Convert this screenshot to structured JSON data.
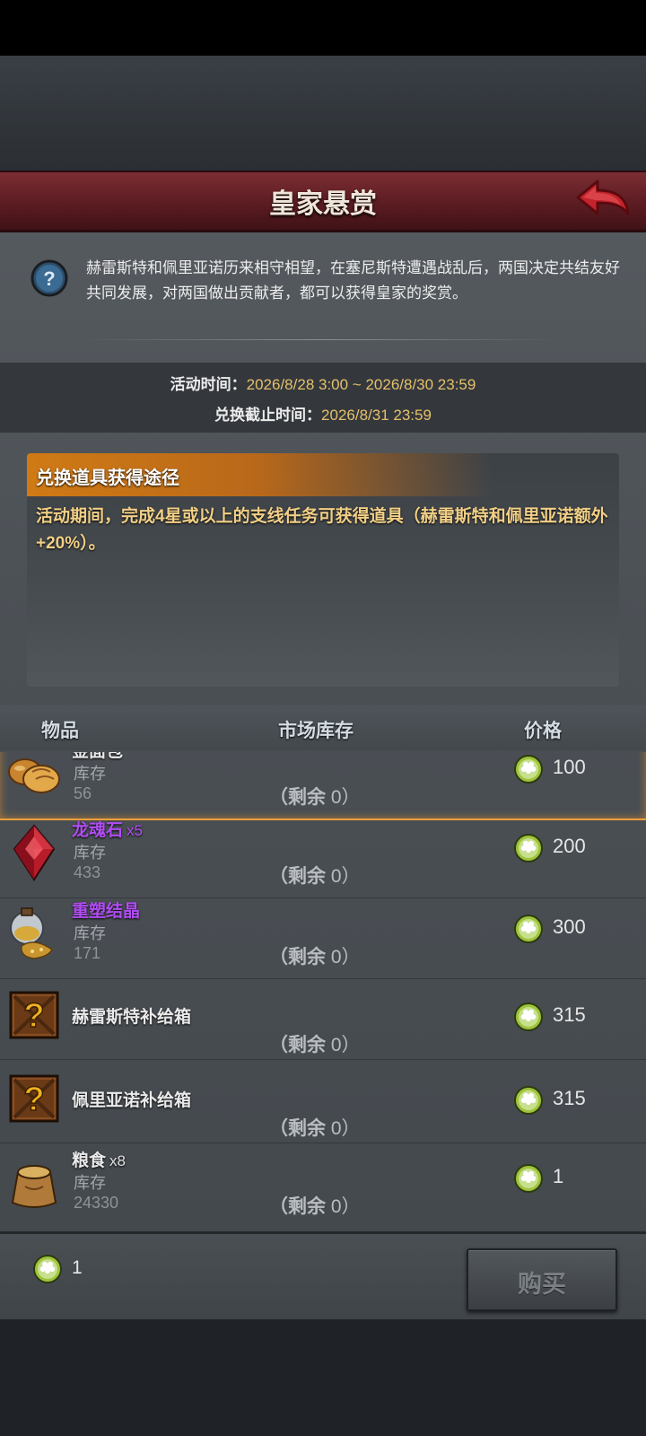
{
  "header": {
    "title": "皇家悬赏"
  },
  "intro": {
    "text": "赫雷斯特和佩里亚诺历来相守相望，在塞尼斯特遭遇战乱后，两国决定共结友好共同发展，对两国做出贡献者，都可以获得皇家的奖赏。"
  },
  "times": {
    "activity_label": "活动时间：",
    "activity_value": "2026/8/28 3:00 ~ 2026/8/30 23:59",
    "exchange_label": "兑换截止时间：",
    "exchange_value": "2026/8/31 23:59"
  },
  "how_to": {
    "heading": "兑换道具获得途径",
    "text": "活动期间，完成4星或以上的支线任务可获得道具（赫雷斯特和佩里亚诺额外+20%）。"
  },
  "columns": {
    "item": "物品",
    "market_stock": "市场库存",
    "price": "价格"
  },
  "items": [
    {
      "name": "金面包",
      "qty": "",
      "stock_label": "库存",
      "stock": "56",
      "remain_label": "（剩余",
      "remain": "0）",
      "price": "100",
      "icon": "bread-icon",
      "selected": true
    },
    {
      "name": "龙魂石",
      "qty": "x5",
      "stock_label": "库存",
      "stock": "433",
      "remain_label": "（剩余",
      "remain": "0）",
      "price": "200",
      "icon": "red-crystal-icon"
    },
    {
      "name": "重塑结晶",
      "qty": "",
      "stock_label": "库存",
      "stock": "171",
      "remain_label": "（剩余",
      "remain": "0）",
      "price": "300",
      "icon": "gold-dust-flask-icon"
    },
    {
      "name": "赫雷斯特补给箱",
      "qty": "",
      "stock_label": "",
      "stock": "",
      "remain_label": "（剩余",
      "remain": "0）",
      "price": "315",
      "icon": "mystery-crate-icon"
    },
    {
      "name": "佩里亚诺补给箱",
      "qty": "",
      "stock_label": "",
      "stock": "",
      "remain_label": "（剩余",
      "remain": "0）",
      "price": "315",
      "icon": "mystery-crate-icon"
    },
    {
      "name": "粮食",
      "qty": "x8",
      "stock_label": "库存",
      "stock": "24330",
      "remain_label": "（剩余",
      "remain": "0）",
      "price": "1",
      "icon": "grain-sack-icon"
    }
  ],
  "wallet": {
    "amount": "1"
  },
  "buy_button": {
    "label": "购买"
  },
  "colors": {
    "accent_orange": "#d07a15",
    "rare_purple": "#b04df2",
    "time_gold": "#e5c06a",
    "title_red": "#6b2329"
  }
}
